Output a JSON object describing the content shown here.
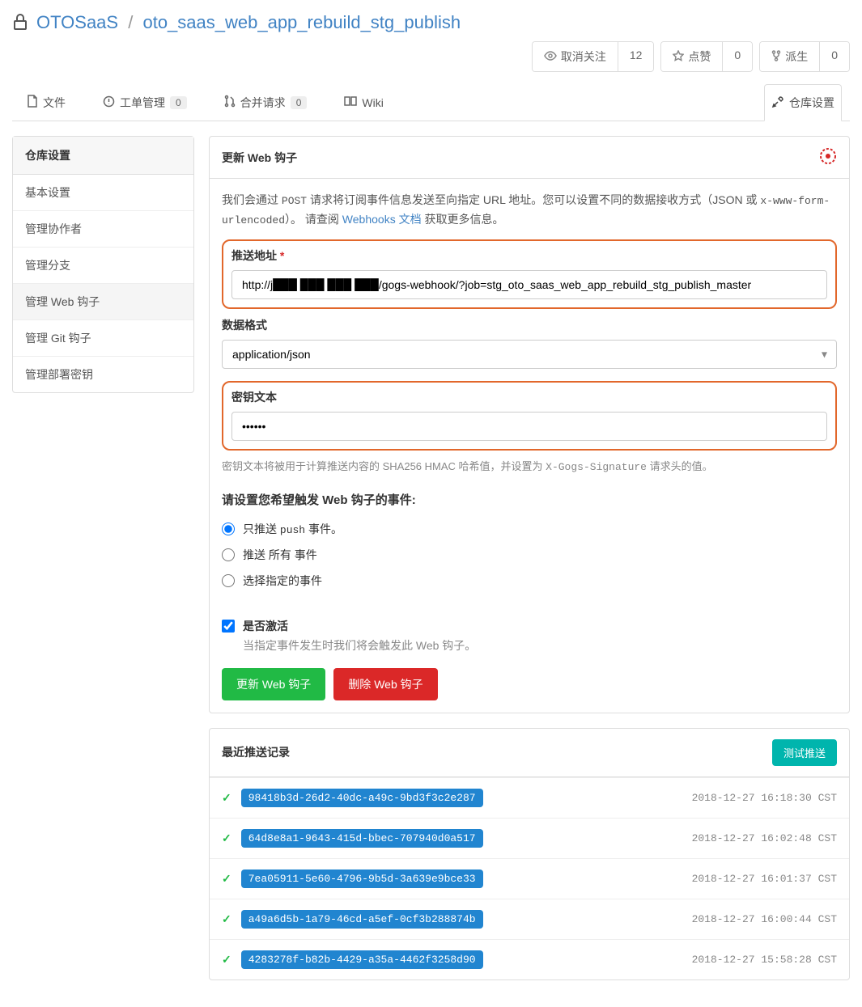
{
  "breadcrumb": {
    "owner": "OTOSaaS",
    "repo": "oto_saas_web_app_rebuild_stg_publish"
  },
  "top_actions": {
    "unwatch": {
      "label": "取消关注",
      "count": "12"
    },
    "star": {
      "label": "点赞",
      "count": "0"
    },
    "fork": {
      "label": "派生",
      "count": "0"
    }
  },
  "tabs": {
    "files": "文件",
    "issues": "工单管理",
    "issues_count": "0",
    "pulls": "合并请求",
    "pulls_count": "0",
    "wiki": "Wiki",
    "settings": "仓库设置"
  },
  "sidebar": {
    "title": "仓库设置",
    "items": [
      "基本设置",
      "管理协作者",
      "管理分支",
      "管理 Web 钩子",
      "管理 Git 钩子",
      "管理部署密钥"
    ]
  },
  "webhook": {
    "title": "更新 Web 钩子",
    "intro_pre": "我们会通过 ",
    "intro_post_method": " 请求将订阅事件信息发送至向指定 URL 地址。您可以设置不同的数据接收方式（JSON 或 ",
    "intro_enc": "x-www-form-urlencoded",
    "intro_tail": "）。 请查阅 ",
    "intro_link": "Webhooks 文档",
    "intro_end": " 获取更多信息。",
    "post": "POST",
    "url_label": "推送地址",
    "url_value": "http://j███ ███ ███ ███/gogs-webhook/?job=stg_oto_saas_web_app_rebuild_stg_publish_master",
    "format_label": "数据格式",
    "format_value": "application/json",
    "secret_label": "密钥文本",
    "secret_value": "••••••",
    "secret_help_pre": "密钥文本将被用于计算推送内容的 SHA256 HMAC 哈希值，并设置为 ",
    "secret_help_sig": "X-Gogs-Signature",
    "secret_help_post": " 请求头的值。",
    "events_title": "请设置您希望触发 Web 钩子的事件:",
    "event_push_pre": "只推送 ",
    "event_push_mono": "push",
    "event_push_post": " 事件。",
    "event_all": "推送 所有 事件",
    "event_custom": "选择指定的事件",
    "active_label": "是否激活",
    "active_help": "当指定事件发生时我们将会触发此 Web 钩子。",
    "btn_update": "更新 Web 钩子",
    "btn_delete": "删除 Web 钩子"
  },
  "deliveries": {
    "title": "最近推送记录",
    "test_btn": "测试推送",
    "rows": [
      {
        "hash": "98418b3d-26d2-40dc-a49c-9bd3f3c2e287",
        "time": "2018-12-27 16:18:30 CST"
      },
      {
        "hash": "64d8e8a1-9643-415d-bbec-707940d0a517",
        "time": "2018-12-27 16:02:48 CST"
      },
      {
        "hash": "7ea05911-5e60-4796-9b5d-3a639e9bce33",
        "time": "2018-12-27 16:01:37 CST"
      },
      {
        "hash": "a49a6d5b-1a79-46cd-a5ef-0cf3b288874b",
        "time": "2018-12-27 16:00:44 CST"
      },
      {
        "hash": "4283278f-b82b-4429-a35a-4462f3258d90",
        "time": "2018-12-27 15:58:28 CST"
      }
    ]
  }
}
